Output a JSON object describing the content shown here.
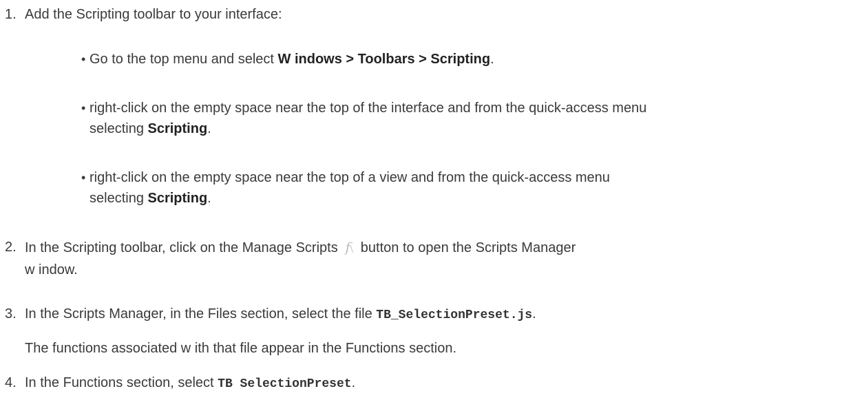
{
  "steps": [
    {
      "number": "1.",
      "text": "Add the Scripting toolbar to your interface:",
      "bullets": [
        {
          "pre": "Go to the top menu and select ",
          "bold": "W indows > Toolbars > Scripting",
          "post": "."
        },
        {
          "line1": "right-click on the empty space near the top of the interface and from the quick-access menu",
          "line2_pre": "selecting ",
          "line2_bold": "Scripting",
          "line2_post": "."
        },
        {
          "line1": "right-click on the empty space near the top of a view and from the quick-access menu",
          "line2_pre": "selecting ",
          "line2_bold": "Scripting",
          "line2_post": "."
        }
      ]
    },
    {
      "number": "2.",
      "line1_pre": "In the Scripting toolbar, click on the Manage Scripts ",
      "icon": "manage-scripts-icon",
      "line1_post": " button to open the Scripts Manager",
      "line2": "w indow."
    },
    {
      "number": "3.",
      "pre": "In the Scripts Manager, in the Files section, select the file ",
      "code": "TB_SelectionPreset.js",
      "post": ".",
      "note": "The functions associated w ith that file appear in the Functions section."
    },
    {
      "number": "4.",
      "pre": "In the Functions section, select ",
      "code": "TB SelectionPreset",
      "post": "."
    }
  ]
}
